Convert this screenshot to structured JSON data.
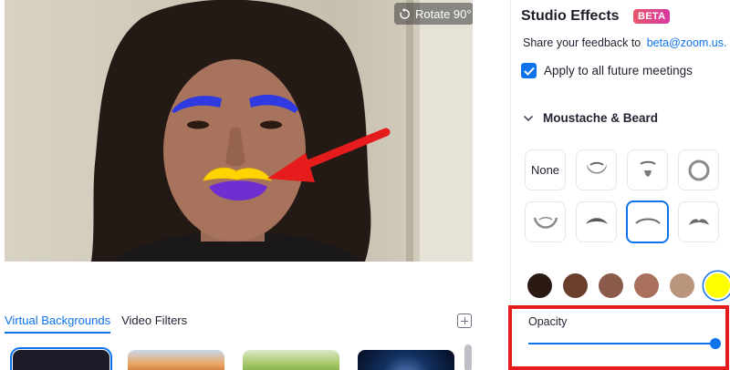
{
  "preview": {
    "rotate_label": "Rotate 90°"
  },
  "tabs": [
    {
      "label": "Virtual Backgrounds",
      "active": true
    },
    {
      "label": "Video Filters",
      "active": false
    }
  ],
  "panel": {
    "title": "Studio Effects",
    "badge": "BETA",
    "feedback_text": "Share your feedback to",
    "feedback_email": "beta@zoom.us.",
    "apply_all_label": "Apply to all future meetings",
    "apply_all_checked": true,
    "section_title": "Moustache & Beard",
    "none_label": "None",
    "opacity_label": "Opacity",
    "opacity_value": 1.0
  },
  "colors": {
    "accent": "#0e72ed",
    "highlight": "#e61b1b",
    "swatches": [
      "#2b1a14",
      "#6b3d2c",
      "#8a5a4a",
      "#a8705d",
      "#b8957c",
      "#ffff00"
    ],
    "selected_swatch": 5
  },
  "icons": {
    "rotate": "rotate-icon",
    "add": "add-icon",
    "chevron": "chevron-down-icon",
    "check": "checkmark-icon"
  }
}
